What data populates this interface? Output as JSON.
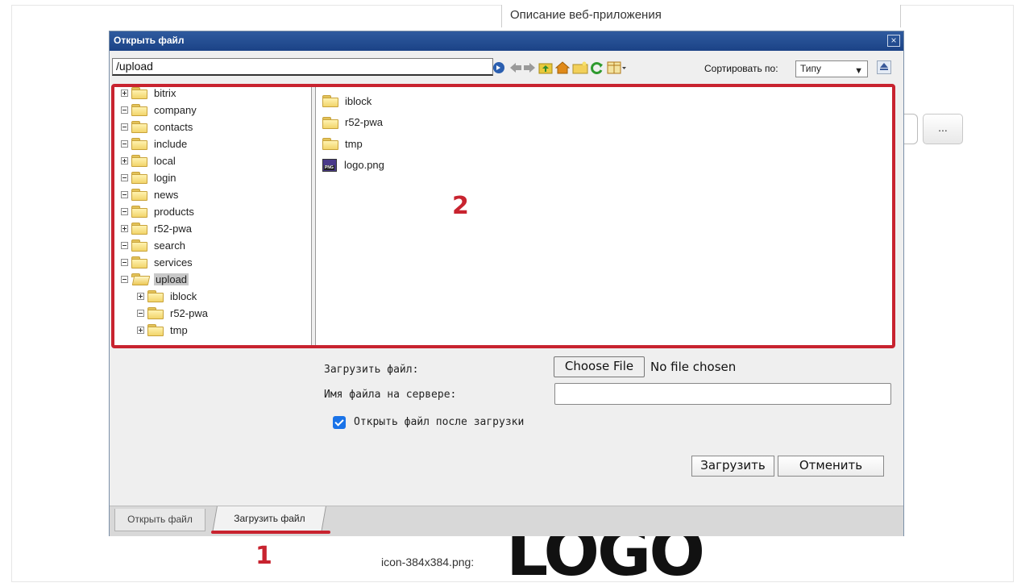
{
  "background": {
    "description_field": "Описание веб-приложения",
    "dots_button": "...",
    "icon_label": "icon-384x384.png:",
    "logo_text": "LOGO"
  },
  "dialog": {
    "title": "Открыть файл",
    "close": "×",
    "path": "/upload",
    "sort_label": "Сортировать по:",
    "sort_value": "Типу",
    "tree": [
      {
        "label": "bitrix",
        "expander": "plus"
      },
      {
        "label": "company",
        "expander": "minus"
      },
      {
        "label": "contacts",
        "expander": "minus"
      },
      {
        "label": "include",
        "expander": "minus"
      },
      {
        "label": "local",
        "expander": "plus"
      },
      {
        "label": "login",
        "expander": "minus"
      },
      {
        "label": "news",
        "expander": "minus"
      },
      {
        "label": "products",
        "expander": "minus"
      },
      {
        "label": "r52-pwa",
        "expander": "plus"
      },
      {
        "label": "search",
        "expander": "minus"
      },
      {
        "label": "services",
        "expander": "minus"
      },
      {
        "label": "upload",
        "expander": "minus",
        "selected": true,
        "open": true
      },
      {
        "label": "iblock",
        "expander": "plus",
        "child": true
      },
      {
        "label": "r52-pwa",
        "expander": "minus",
        "child": true
      },
      {
        "label": "tmp",
        "expander": "plus",
        "child": true
      }
    ],
    "files": [
      {
        "label": "iblock",
        "type": "folder"
      },
      {
        "label": "r52-pwa",
        "type": "folder"
      },
      {
        "label": "tmp",
        "type": "folder"
      },
      {
        "label": "logo.png",
        "type": "png"
      }
    ],
    "upload_form": {
      "file_label": "Загрузить файл:",
      "choose_button": "Choose File",
      "no_file": "No file chosen",
      "server_name_label": "Имя файла на сервере:",
      "server_name_value": "",
      "open_after_label": "Открыть файл после загрузки",
      "open_after_checked": true,
      "upload_button": "Загрузить",
      "cancel_button": "Отменить"
    },
    "tabs": [
      {
        "label": "Открыть файл",
        "active": false
      },
      {
        "label": "Загрузить файл",
        "active": true
      }
    ]
  },
  "annotations": {
    "marker_1": "1",
    "marker_2": "2"
  },
  "colors": {
    "titlebar": "#1b4286",
    "annotation_red": "#c8232f",
    "checkbox": "#1a73e8"
  }
}
